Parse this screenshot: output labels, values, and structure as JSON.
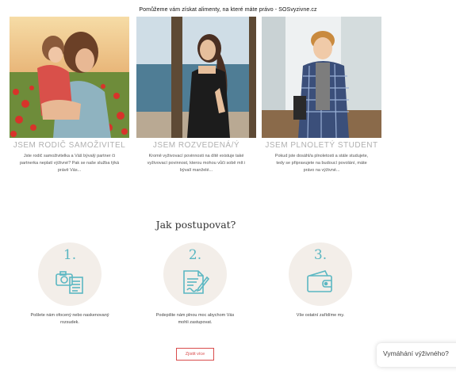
{
  "header": {
    "tagline": "Pomůžeme vám získat alimenty, na které máte právo - SOSvyzivne.cz"
  },
  "cards": [
    {
      "title": "JSEM RODIČ SAMOŽIVITEL",
      "desc": "Jste rodič samoživitelka a Váš bývalý partner či partnerka neplatí výživné? Pak se naše služba týká právě Vás..."
    },
    {
      "title": "JSEM ROZVEDENÁ/Ý",
      "desc": "Kromě vyživovací povinnosti na dítě existuje také vyživovací povinnost, kterou mohou vůči sobě mít i bývalí manželé..."
    },
    {
      "title": "JSEM PLNOLETÝ STUDENT",
      "desc": "Pokud jste dosáhl/a plnoletosti a stále studujete, tedy se připravujete na budoucí povolání, máte právo na výživné..."
    }
  ],
  "how": {
    "heading": "Jak postupovat?",
    "steps": [
      {
        "number": "1.",
        "icon": "camera-document-icon",
        "text": "Pošlete nám ofocený nebo naskenovaný rozsudek."
      },
      {
        "number": "2.",
        "icon": "document-sign-icon",
        "text": "Podepište nám plnou moc abychom Vás mohli zastupovat."
      },
      {
        "number": "3.",
        "icon": "wallet-icon",
        "text": "Vše ostatní zařídíme my."
      }
    ]
  },
  "cta": {
    "label": "Zjistit více"
  },
  "chat": {
    "label": "Vymáhání výživného?"
  },
  "colors": {
    "accent": "#5bb7c2",
    "circle_bg": "#f3eee9",
    "cta_red": "#d94c4c",
    "title_gray": "#b0b0b0"
  }
}
